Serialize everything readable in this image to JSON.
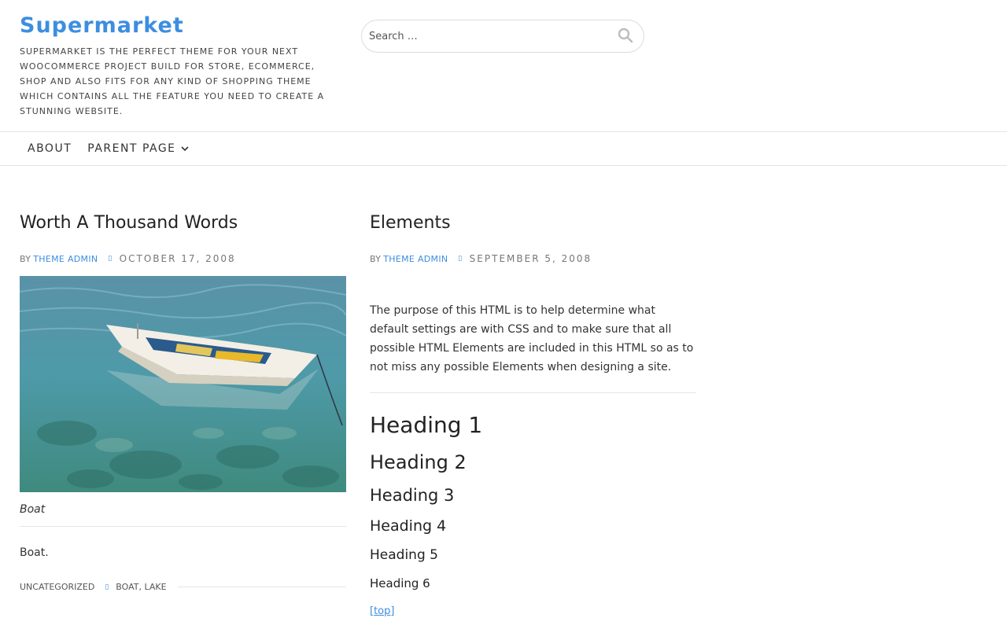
{
  "header": {
    "site_title": "Supermarket",
    "site_description": "SUPERMARKET IS THE PERFECT THEME FOR YOUR NEXT WOOCOMMERCE PROJECT BUILD FOR STORE, ECOMMERCE, SHOP AND ALSO FITS FOR ANY KIND OF SHOPPING THEME WHICH CONTAINS ALL THE FEATURE YOU NEED TO CREATE A STUNNING WEBSITE.",
    "search": {
      "placeholder": "Search …",
      "value": "",
      "icon": "search-icon"
    }
  },
  "nav": {
    "items": [
      {
        "label": "ABOUT"
      },
      {
        "label": "PARENT PAGE",
        "icon": "chevron-down-icon"
      }
    ]
  },
  "posts": [
    {
      "title": "Worth A Thousand Words",
      "by": "BY",
      "author": "THEME ADMIN",
      "date": "OCTOBER 17, 2008",
      "meta_icon": "calendar-icon",
      "image_alt": "Boat",
      "caption": "Boat",
      "excerpt": "Boat.",
      "category": "UNCATEGORIZED",
      "tags": "BOAT, LAKE",
      "tag_icon": "tag-icon"
    },
    {
      "title": "Elements",
      "by": "BY",
      "author": "THEME ADMIN",
      "date": "SEPTEMBER 5, 2008",
      "meta_icon": "calendar-icon",
      "intro": "The purpose of this HTML is to help determine what default settings are with CSS and to make sure that all possible HTML Elements are included in this HTML so as to not miss any possible Elements when designing a site.",
      "headings": [
        "Heading 1",
        "Heading 2",
        "Heading 3",
        "Heading 4",
        "Heading 5",
        "Heading 6"
      ],
      "top_link": "[top]"
    }
  ],
  "colors": {
    "accent": "#3d8ee0",
    "text": "#333333",
    "border": "#e5e5e5"
  }
}
